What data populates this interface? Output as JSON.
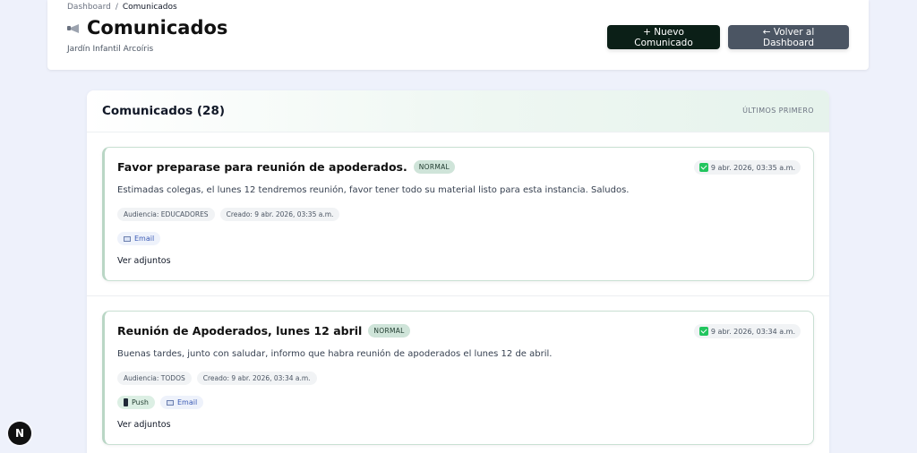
{
  "breadcrumb": {
    "root": "Dashboard",
    "separator": "/",
    "current": "Comunicados"
  },
  "header": {
    "title": "Comunicados",
    "title_icon": "megaphone-icon",
    "subtitle": "Jardín Infantil Arcoíris",
    "new_button": "+ Nuevo Comunicado",
    "back_button": "← Volver al Dashboard"
  },
  "list": {
    "title": "Comunicados (28)",
    "sort_label": "ÚLTIMOS PRIMERO",
    "items": [
      {
        "title": "Favor preparase para reunión de apoderados.",
        "priority": "NORMAL",
        "sent_at": "9 abr. 2026, 03:35 a.m.",
        "body": "Estimadas colegas, el lunes 12 tendremos reunión, favor tener todo su material listo para esta instancia. Saludos.",
        "audience": "Audiencia: EDUCADORES",
        "created": "Creado: 9 abr. 2026, 03:35 a.m.",
        "channels": {
          "email": "Email"
        },
        "attachments": "Ver adjuntos"
      },
      {
        "title": "Reunión de Apoderados, lunes 12 abril",
        "priority": "NORMAL",
        "sent_at": "9 abr. 2026, 03:34 a.m.",
        "body": "Buenas tardes, junto con saludar, informo que habra reunión de apoderados el lunes 12 de abril.",
        "audience": "Audiencia: TODOS",
        "created": "Creado: 9 abr. 2026, 03:34 a.m.",
        "channels": {
          "push": "Push",
          "email": "Email"
        },
        "attachments": "Ver adjuntos"
      }
    ]
  },
  "devtools": {
    "logo_letter": "N"
  },
  "colors": {
    "primary_button": "#0b1f17",
    "secondary_button": "#4b5563",
    "card_border": "#c9e0d3",
    "priority_badge": "#cfe4d9",
    "background": "#eef1fb"
  }
}
